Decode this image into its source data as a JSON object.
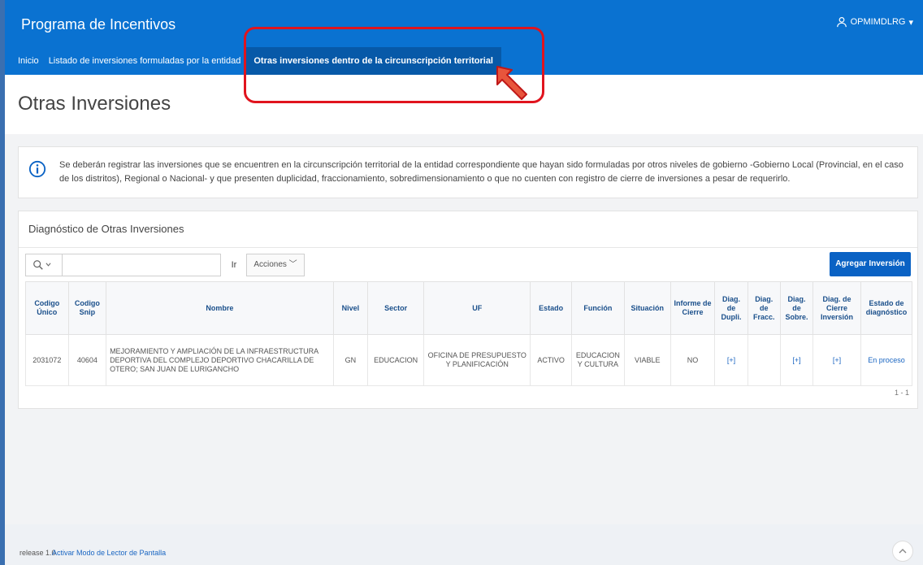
{
  "app": {
    "title": "Programa de Incentivos",
    "user": "OPMIMDLRG"
  },
  "nav": [
    {
      "label": "Inicio"
    },
    {
      "label": "Listado de inversiones formuladas por la entidad"
    },
    {
      "label": "Otras inversiones dentro de la circunscripción territorial"
    }
  ],
  "page": {
    "title": "Otras Inversiones"
  },
  "alert": {
    "text": "Se deberán registrar las inversiones que se encuentren en la circunscripción territorial de la entidad correspondiente que hayan sido formuladas por otros niveles de gobierno -Gobierno Local (Provincial, en el caso de los distritos), Regional o Nacional- y que presenten duplicidad, fraccionamiento, sobredimensionamiento o que no cuenten con registro de cierre de inversiones a pesar de requerirlo."
  },
  "region": {
    "title": "Diagnóstico de Otras Inversiones",
    "go_label": "Ir",
    "actions_label": "Acciones",
    "add_label": "Agregar Inversión",
    "pagination": "1 - 1"
  },
  "table": {
    "headers": [
      "Codigo Único",
      "Codigo Snip",
      "Nombre",
      "Nivel",
      "Sector",
      "UF",
      "Estado",
      "Función",
      "Situación",
      "Informe de Cierre",
      "Diag. de Dupli.",
      "Diag. de Fracc.",
      "Diag. de Sobre.",
      "Diag. de Cierre Inversión",
      "Estado de diagnóstico"
    ],
    "rows": [
      [
        "2031072",
        "40604",
        "MEJORAMIENTO Y AMPLIACIÓN DE LA INFRAESTRUCTURA DEPORTIVA DEL COMPLEJO DEPORTIVO CHACARILLA DE OTERO; SAN JUAN DE LURIGANCHO",
        "GN",
        "EDUCACION",
        "OFICINA DE PRESUPUESTO Y PLANIFICACIÓN",
        "ACTIVO",
        "EDUCACION Y CULTURA",
        "VIABLE",
        "NO",
        "[+]",
        "",
        "[+]",
        "[+]",
        "En proceso"
      ]
    ]
  },
  "footer": {
    "release": "release 1.0",
    "reader_link": "Activar Modo de Lector de Pantalla"
  },
  "colors": {
    "header_blue": "#0a72d1",
    "highlight_red": "#e0141e",
    "primary_button": "#0a62c4"
  }
}
